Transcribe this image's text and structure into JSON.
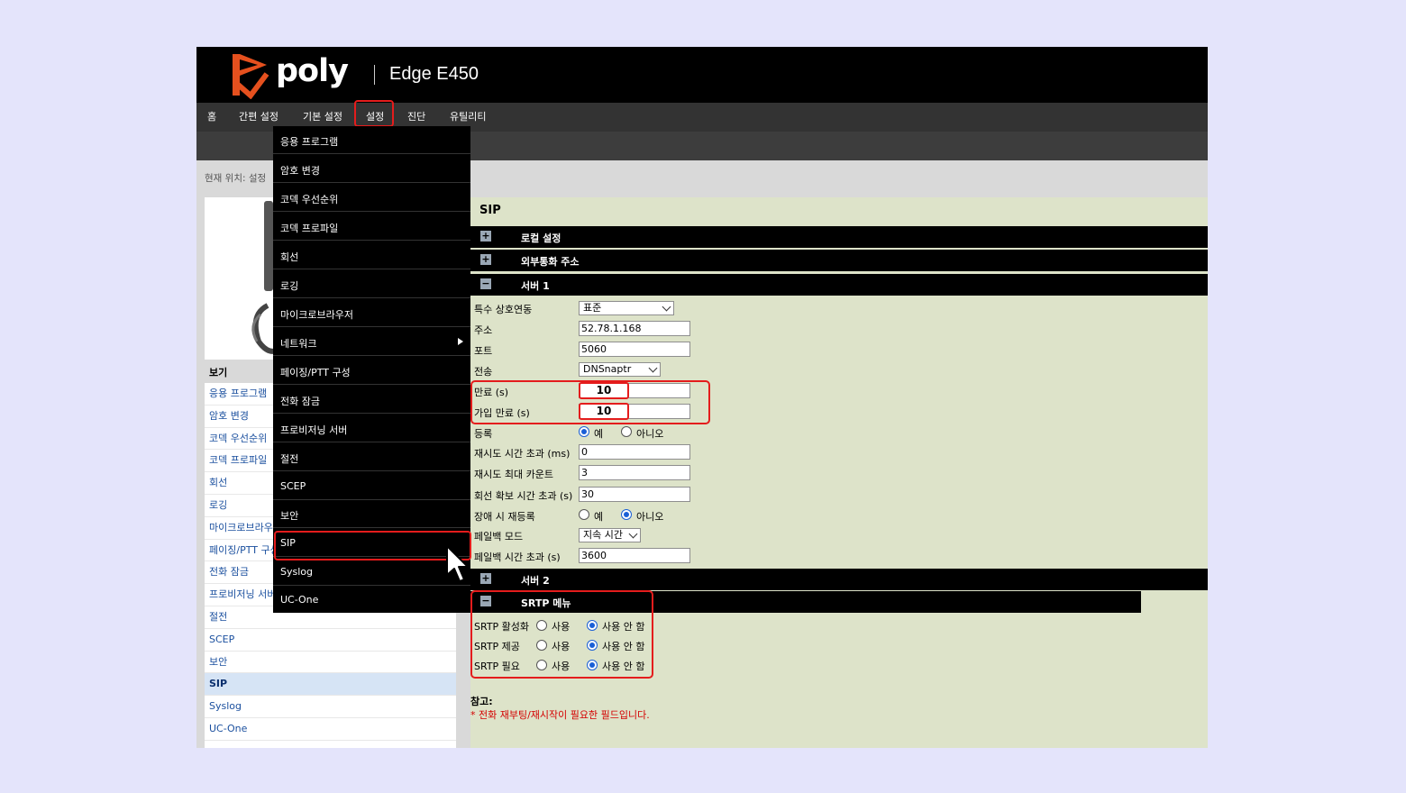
{
  "header": {
    "brand": "poly",
    "model": "Edge E450"
  },
  "nav": {
    "items": [
      "홈",
      "간편 설정",
      "기본 설정",
      "설정",
      "진단",
      "유틸리티"
    ]
  },
  "breadcrumb": "현재 위치: 설정",
  "left_panel": {
    "view_header": "보기",
    "items": [
      "응용 프로그램",
      "암호 변경",
      "코덱 우선순위",
      "코덱 프로파일",
      "회선",
      "로깅",
      "마이크로브라우저",
      "페이징/PTT 구성",
      "전화 잠금",
      "프로비저닝 서버",
      "절전",
      "SCEP",
      "보안",
      "SIP",
      "Syslog",
      "UC-One"
    ],
    "active": "SIP"
  },
  "dropdown": {
    "items": [
      "응용 프로그램",
      "암호 변경",
      "코덱 우선순위",
      "코덱 프로파일",
      "회선",
      "로깅",
      "마이크로브라우저",
      "네트워크",
      "페이징/PTT 구성",
      "전화 잠금",
      "프로비저닝 서버",
      "절전",
      "SCEP",
      "보안",
      "SIP",
      "Syslog",
      "UC-One"
    ]
  },
  "main": {
    "title": "SIP",
    "sections": {
      "local": "로컬 설정",
      "outbound": "외부통화 주소",
      "server1": "서버 1",
      "server2": "서버 2",
      "srtp": "SRTP 메뉴"
    },
    "server1": {
      "special_interop": {
        "label": "특수 상호연동",
        "value": "표준"
      },
      "address": {
        "label": "주소",
        "value": "52.78.1.168"
      },
      "port": {
        "label": "포트",
        "value": "5060"
      },
      "transport": {
        "label": "전송",
        "value": "DNSnaptr"
      },
      "expires": {
        "label": "만료 (s)",
        "value": "10"
      },
      "sub_expires": {
        "label": "가입 만료 (s)",
        "value": "10"
      },
      "register": {
        "label": "등록",
        "yes": "예",
        "no": "아니오"
      },
      "retry_timeout": {
        "label": "재시도 시간 초과 (ms)",
        "value": "0"
      },
      "retry_max": {
        "label": "재시도 최대 카운트",
        "value": "3"
      },
      "line_seize": {
        "label": "회선 확보 시간 초과 (s)",
        "value": "30"
      },
      "fail_rereg": {
        "label": "장애 시 재등록",
        "yes": "예",
        "no": "아니오"
      },
      "failback_mode": {
        "label": "페일백 모드",
        "value": "지속 시간"
      },
      "failback_timeout": {
        "label": "페일백 시간 초과 (s)",
        "value": "3600"
      }
    },
    "srtp": {
      "enable": {
        "label": "SRTP 활성화",
        "on": "사용",
        "off": "사용 안 함"
      },
      "offer": {
        "label": "SRTP 제공",
        "on": "사용",
        "off": "사용 안 함"
      },
      "require": {
        "label": "SRTP 필요",
        "on": "사용",
        "off": "사용 안 함"
      }
    },
    "note_title": "참고:",
    "note_text": "* 전화 재부팅/재시작이 필요한 필드입니다."
  },
  "colors": {
    "accent_red": "#e41c1c",
    "brand_orange": "#e5501e",
    "link_blue": "#1a4f9e",
    "panel_green": "#dde3c9"
  }
}
